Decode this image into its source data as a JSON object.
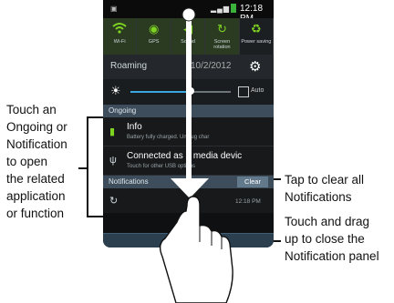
{
  "status_bar": {
    "time": "12:18 PM"
  },
  "toggles": [
    {
      "label": "Wi-Fi",
      "icon": "wifi-icon"
    },
    {
      "label": "GPS",
      "icon": "gps-icon"
    },
    {
      "label": "Sound",
      "icon": "sound-icon"
    },
    {
      "label": "Screen rotation",
      "icon": "rotation-icon"
    },
    {
      "label": "Power saving",
      "icon": "power-saving-icon"
    }
  ],
  "roaming": {
    "label": "Roaming",
    "date": "10/2/2012"
  },
  "brightness": {
    "auto_label": "Auto",
    "level": 0.6
  },
  "ongoing": {
    "header": "Ongoing",
    "items": [
      {
        "title": "Info",
        "subtitle": "Battery fully charged. Unplug char"
      },
      {
        "title": "Connected as a media devic",
        "subtitle": "Touch for other USB options"
      }
    ]
  },
  "notifications": {
    "header": "Notifications",
    "clear_label": "Clear",
    "items": [
      {
        "time": "12:18 PM"
      }
    ]
  },
  "callouts": {
    "left": [
      "Touch an",
      "Ongoing or",
      "Notification",
      "to open",
      "the related",
      "application",
      "or function"
    ],
    "right_top": [
      "Tap to clear all",
      "Notifications"
    ],
    "right_bottom": [
      "Touch and drag",
      "up to close the",
      "Notification panel"
    ]
  },
  "colors": {
    "accent_green": "#7ed321",
    "header_bg": "#3d4d5b",
    "clear_bg": "#62798c"
  }
}
